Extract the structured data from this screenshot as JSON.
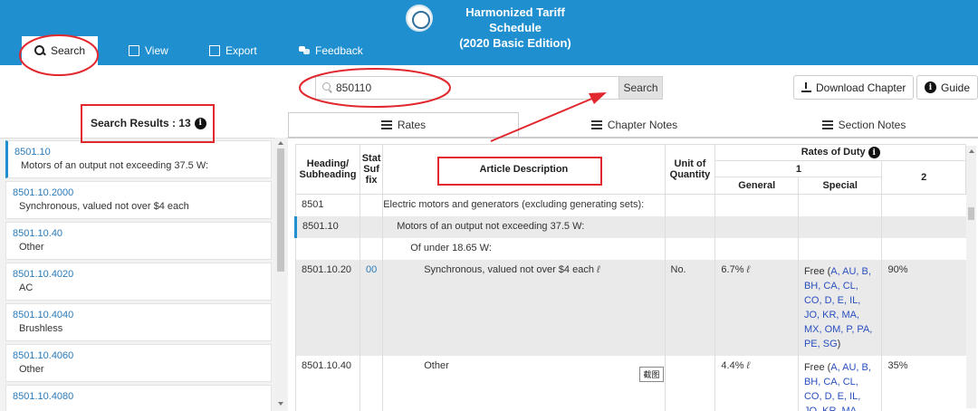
{
  "header": {
    "title_line1": "Harmonized Tariff Schedule",
    "title_line2": "(2020 Basic Edition)"
  },
  "nav": [
    {
      "label": "Search",
      "icon": "search-icon",
      "active": true
    },
    {
      "label": "View",
      "icon": "document-icon"
    },
    {
      "label": "Export",
      "icon": "export-icon"
    },
    {
      "label": "Feedback",
      "icon": "feedback-icon"
    }
  ],
  "search": {
    "value": "850110",
    "button_label": "Search"
  },
  "toolbar": {
    "download_label": "Download Chapter",
    "guide_label": "Guide"
  },
  "results": {
    "label": "Search Results : 13",
    "items": [
      {
        "code": "8501.10",
        "desc": "Motors of an output not exceeding 37.5 W:"
      },
      {
        "code": "8501.10.2000",
        "desc": "Synchronous, valued not over $4 each"
      },
      {
        "code": "8501.10.40",
        "desc": "Other"
      },
      {
        "code": "8501.10.4020",
        "desc": "AC"
      },
      {
        "code": "8501.10.4040",
        "desc": "Brushless"
      },
      {
        "code": "8501.10.4060",
        "desc": "Other"
      },
      {
        "code": "8501.10.4080",
        "desc": ""
      }
    ]
  },
  "tabs": [
    {
      "label": "Rates",
      "active": true
    },
    {
      "label": "Chapter Notes"
    },
    {
      "label": "Section Notes"
    }
  ],
  "table": {
    "headers": {
      "heading": "Heading/ Subheading",
      "stat": "Stat Suf fix",
      "article": "Article Description",
      "unit": "Unit of Quantity",
      "rates": "Rates of Duty",
      "col1": "1",
      "general": "General",
      "special": "Special",
      "col2": "2"
    },
    "rows": [
      {
        "heading": "8501",
        "stat": "",
        "desc": "Electric motors and generators (excluding generating sets):",
        "unit": "",
        "general": "",
        "special_prefix": "",
        "special_links": "",
        "special_suffix": "",
        "col2": ""
      },
      {
        "heading": "8501.10",
        "stat": "",
        "desc": "Motors of an output not exceeding 37.5 W:",
        "unit": "",
        "general": "",
        "special_prefix": "",
        "special_links": "",
        "special_suffix": "",
        "col2": ""
      },
      {
        "heading": "",
        "stat": "",
        "desc": "Of under 18.65 W:",
        "unit": "",
        "general": "",
        "special_prefix": "",
        "special_links": "",
        "special_suffix": "",
        "col2": ""
      },
      {
        "heading": "8501.10.20",
        "stat": "00",
        "desc": "Synchronous, valued not over $4 each",
        "unit": "No.",
        "general": "6.7%",
        "special_prefix": "Free (",
        "special_links": "A, AU, B, BH, CA, CL, CO, D, E, IL, JO, KR, MA, MX, OM, P, PA, PE, SG",
        "special_suffix": ")",
        "col2": "90%"
      },
      {
        "heading": "8501.10.40",
        "stat": "",
        "desc": "Other",
        "unit": "",
        "general": "4.4%",
        "special_prefix": "Free (",
        "special_links": "A, AU, B, BH, CA, CL, CO, D, E, IL, JO, KR, MA,",
        "special_suffix": "",
        "col2": "35%"
      }
    ],
    "footnote_mark": "ℓ"
  },
  "tooltip": "截图"
}
